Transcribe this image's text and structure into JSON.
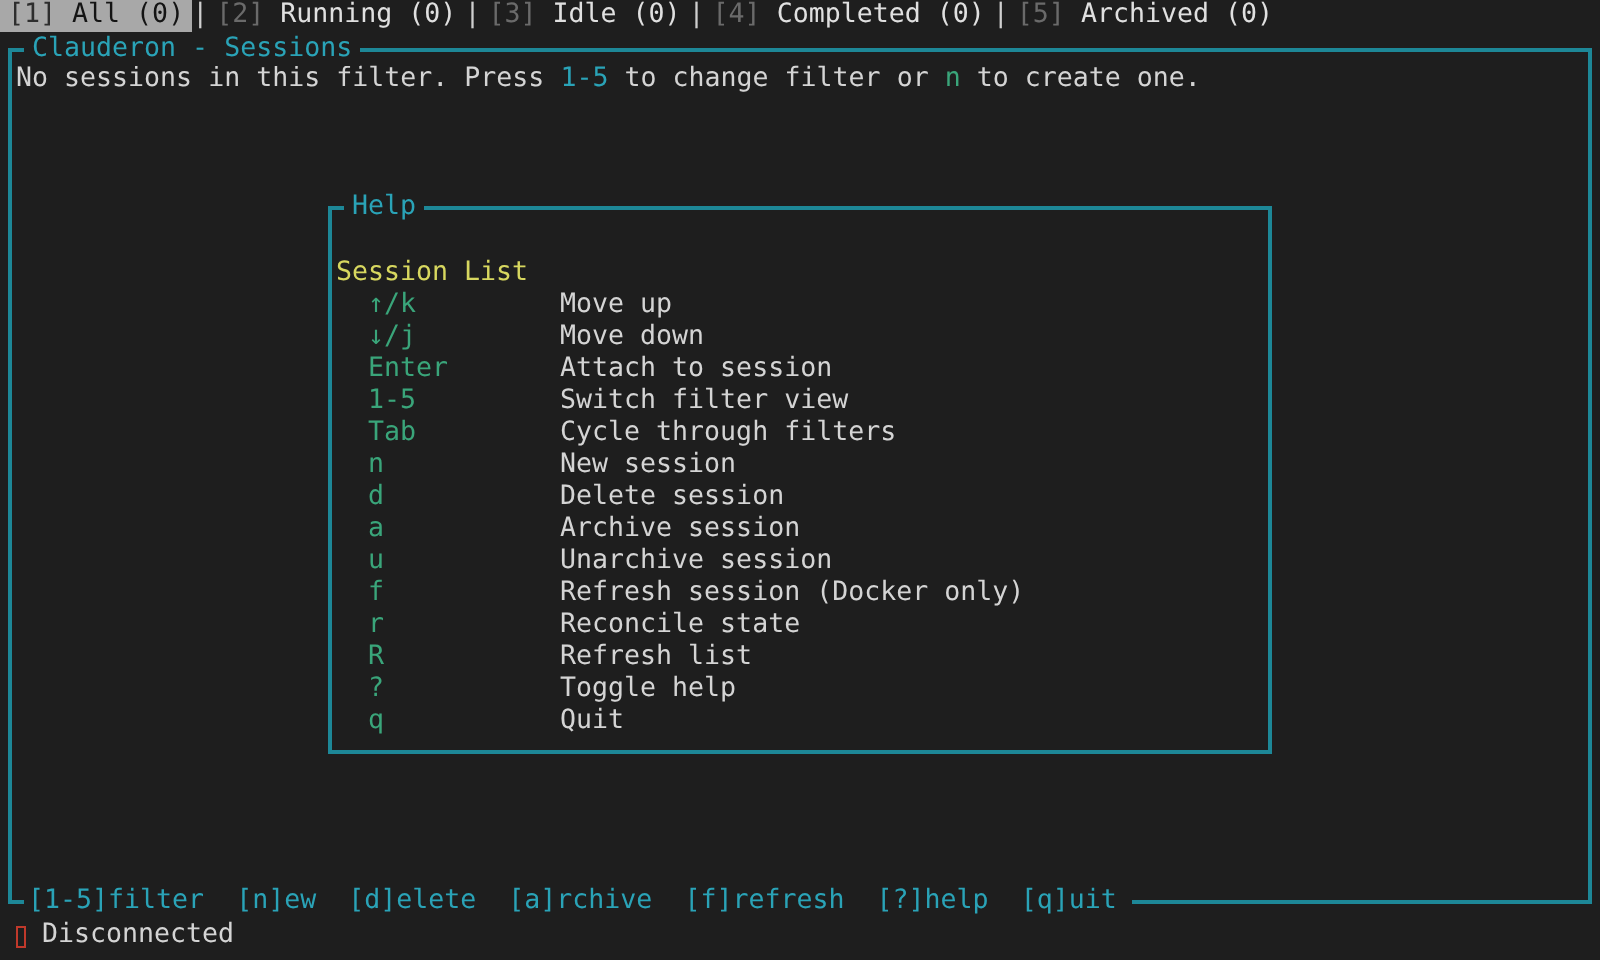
{
  "tabs": [
    {
      "number": "[1]",
      "label": "All (0)",
      "selected": true,
      "separator": "|"
    },
    {
      "number": "[2]",
      "label": "Running (0)",
      "selected": false,
      "separator": "|"
    },
    {
      "number": "[3]",
      "label": "Idle (0)",
      "selected": false,
      "separator": "|"
    },
    {
      "number": "[4]",
      "label": "Completed (0)",
      "selected": false,
      "separator": "|"
    },
    {
      "number": "[5]",
      "label": "Archived (0)",
      "selected": false
    }
  ],
  "panel": {
    "title": "Clauderon - Sessions",
    "message": [
      {
        "text": "No sessions in this filter. Press ",
        "kind": "plain"
      },
      {
        "text": "1-5",
        "kind": "key"
      },
      {
        "text": " to change filter or ",
        "kind": "plain"
      },
      {
        "text": "n",
        "kind": "action"
      },
      {
        "text": " to create one.",
        "kind": "plain"
      }
    ],
    "footer": [
      "[1-5]filter",
      "[n]ew",
      "[d]elete",
      "[a]rchive",
      "[f]refresh",
      "[?]help",
      "[q]uit"
    ]
  },
  "help": {
    "title": "Help",
    "section": "Session List",
    "bindings": [
      {
        "key": "↑/k",
        "action": "Move up"
      },
      {
        "key": "↓/j",
        "action": "Move down"
      },
      {
        "key": "Enter",
        "action": "Attach to session"
      },
      {
        "key": "1-5",
        "action": "Switch filter view"
      },
      {
        "key": "Tab",
        "action": "Cycle through filters"
      },
      {
        "key": "n",
        "action": "New session"
      },
      {
        "key": "d",
        "action": "Delete session"
      },
      {
        "key": "a",
        "action": "Archive session"
      },
      {
        "key": "u",
        "action": "Unarchive session"
      },
      {
        "key": "f",
        "action": "Refresh session (Docker only)"
      },
      {
        "key": "r",
        "action": "Reconcile state"
      },
      {
        "key": "R",
        "action": "Refresh list"
      },
      {
        "key": "?",
        "action": "Toggle help"
      },
      {
        "key": "q",
        "action": "Quit"
      }
    ]
  },
  "status": {
    "text": "Disconnected",
    "connected": false
  }
}
